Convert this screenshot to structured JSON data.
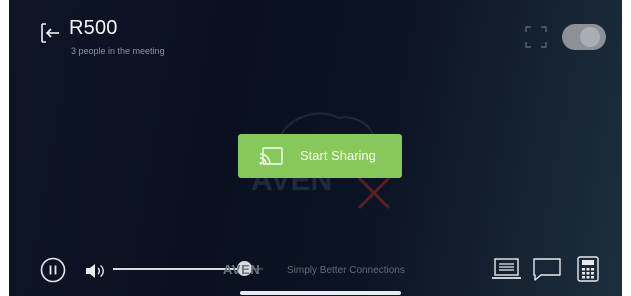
{
  "header": {
    "room_name": "R500",
    "participants_text": "3 people in the meeting"
  },
  "main": {
    "share_button_label": "Start Sharing",
    "watermark_text": "AVEN",
    "accent_color": "#86c85a"
  },
  "footer": {
    "brand_name": "AVEN",
    "brand_tagline": "Simply Better Connections",
    "volume_level": 0.87
  },
  "icons": {
    "back": "exit-arrow-icon",
    "fullscreen": "fullscreen-icon",
    "toggle": "toggle-switch",
    "share": "screen-cast-icon",
    "play_pause": "pause-icon",
    "volume": "speaker-icon",
    "presentation": "presentation-icon",
    "chat": "chat-bubble-icon",
    "keypad": "keypad-icon"
  }
}
